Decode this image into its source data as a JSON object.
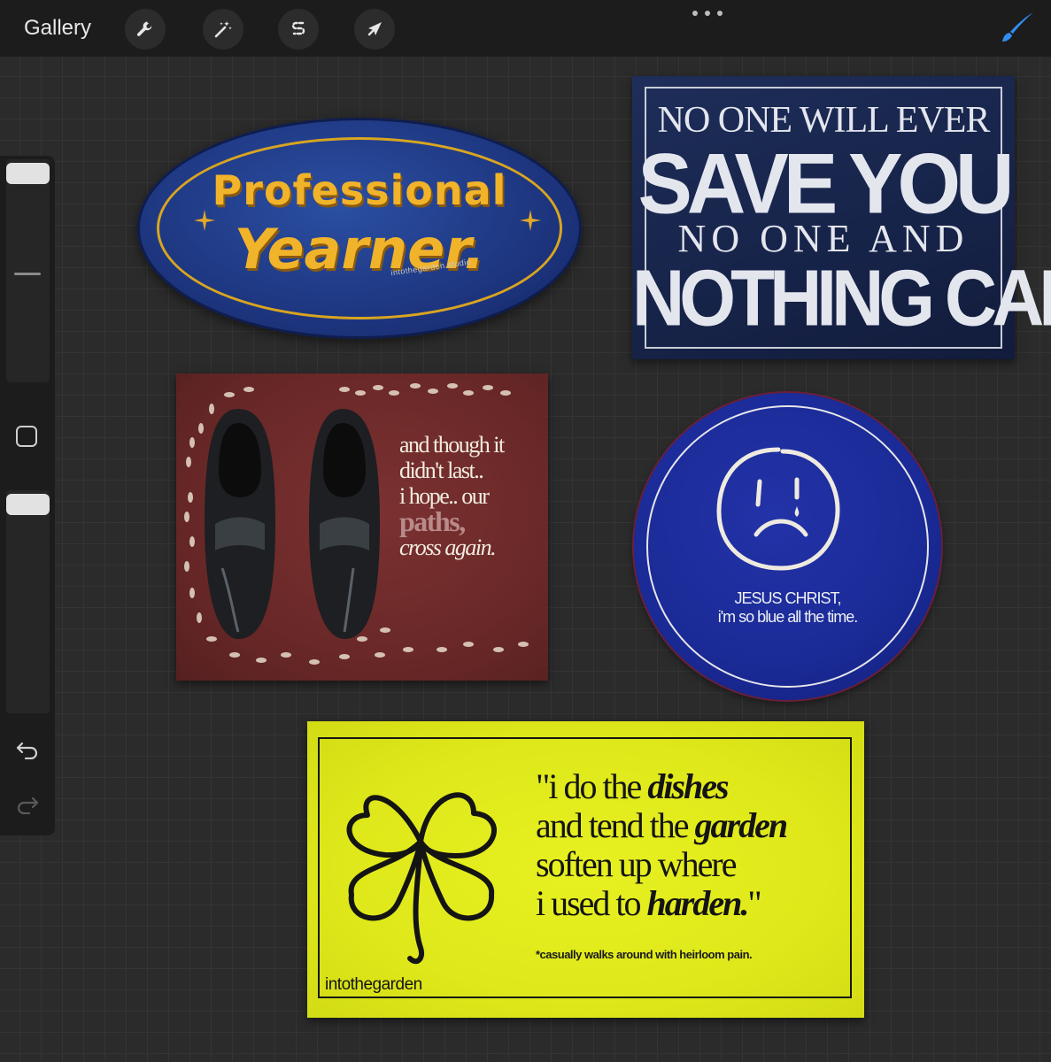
{
  "toolbar": {
    "gallery_label": "Gallery",
    "tools": [
      {
        "name": "actions",
        "icon": "wrench-icon"
      },
      {
        "name": "adjustments",
        "icon": "magic-wand-icon"
      },
      {
        "name": "selection",
        "icon": "selection-s-icon"
      },
      {
        "name": "transform",
        "icon": "arrow-cursor-icon"
      }
    ],
    "more_icon": "ellipsis-icon",
    "brush_icon": "brush-icon",
    "accent_color": "#2f8ef0"
  },
  "sidebar": {
    "brush_size_icon": "slider-knob",
    "modify_icon": "square-icon",
    "opacity_icon": "slider-knob",
    "undo_icon": "undo-icon",
    "redo_icon": "redo-icon"
  },
  "patches": {
    "yearner": {
      "line1": "Professional",
      "line2": "Yearner.",
      "credit": "intothegarden.studio",
      "colors": {
        "fabric": "#1b3178",
        "thread": "#f1b32a"
      }
    },
    "save": {
      "line1": "NO ONE WILL EVER",
      "line2": "SAVE YOU",
      "line3": "NO ONE AND",
      "line4": "NOTHING CAN",
      "colors": {
        "fabric": "#17244a",
        "thread": "#e4e6ee"
      }
    },
    "shoes": {
      "lines": [
        "and though it",
        "didn't last..",
        "i hope.. our",
        "paths,",
        "cross again."
      ],
      "colors": {
        "fabric": "#6a2828",
        "thread": "#f2ece0"
      }
    },
    "blue": {
      "line1": "JESUS CHRIST,",
      "line2": "i'm so blue all the time.",
      "face_icon": "sad-face-icon",
      "colors": {
        "fabric": "#1a2a96",
        "thread": "#eef0f5"
      }
    },
    "yellow": {
      "line1_a": "\"i do the ",
      "line1_b": "dishes",
      "line2_a": "and tend the ",
      "line2_b": "garden",
      "line3": "soften up where",
      "line4_a": "i used to ",
      "line4_b": "harden.",
      "line4_c": "\"",
      "footnote": "*casually walks around with heirloom pain.",
      "brand": "intothegarden",
      "clover_icon": "four-leaf-clover-icon",
      "colors": {
        "fabric": "#dfe81a",
        "thread": "#141414"
      }
    }
  }
}
